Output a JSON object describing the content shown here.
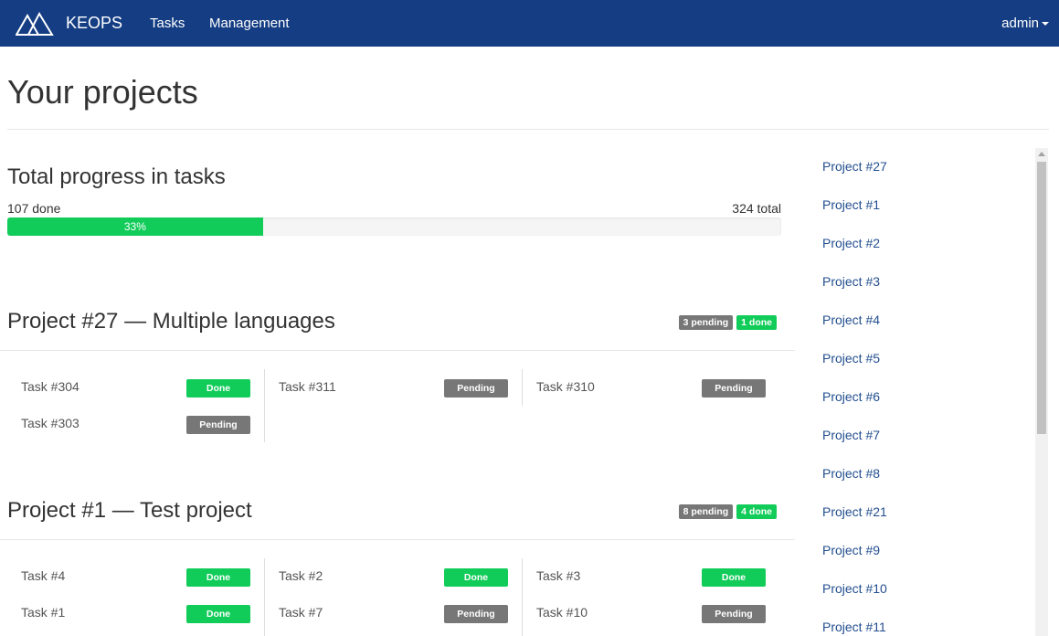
{
  "app": {
    "name": "KEOPS",
    "nav": {
      "tasks": "Tasks",
      "management": "Management"
    },
    "user": "admin"
  },
  "page": {
    "title": "Your projects"
  },
  "progress": {
    "title": "Total progress in tasks",
    "done_label": "107 done",
    "total_label": "324 total",
    "percent_label": "33%",
    "done": 107,
    "total": 324
  },
  "projects": [
    {
      "title": "Project #27 — Multiple languages",
      "pending_label": "3 pending",
      "done_label": "1 done",
      "columns": [
        [
          {
            "name": "Task #304",
            "status": "Done"
          },
          {
            "name": "Task #303",
            "status": "Pending"
          }
        ],
        [
          {
            "name": "Task #311",
            "status": "Pending"
          }
        ],
        [
          {
            "name": "Task #310",
            "status": "Pending"
          }
        ]
      ]
    },
    {
      "title": "Project #1 — Test project",
      "pending_label": "8 pending",
      "done_label": "4 done",
      "columns": [
        [
          {
            "name": "Task #4",
            "status": "Done"
          },
          {
            "name": "Task #1",
            "status": "Done"
          }
        ],
        [
          {
            "name": "Task #2",
            "status": "Done"
          },
          {
            "name": "Task #7",
            "status": "Pending"
          }
        ],
        [
          {
            "name": "Task #3",
            "status": "Done"
          },
          {
            "name": "Task #10",
            "status": "Pending"
          }
        ]
      ]
    }
  ],
  "sidebar": {
    "items": [
      "Project #27",
      "Project #1",
      "Project #2",
      "Project #3",
      "Project #4",
      "Project #5",
      "Project #6",
      "Project #7",
      "Project #8",
      "Project #21",
      "Project #9",
      "Project #10",
      "Project #11"
    ]
  },
  "colors": {
    "navbar": "#143d83",
    "success": "#12cc5a",
    "pending": "#777777",
    "link": "#234f8f"
  },
  "icons": {
    "logo": "keops-pyramids-logo-icon",
    "user_caret": "caret-down-icon"
  }
}
